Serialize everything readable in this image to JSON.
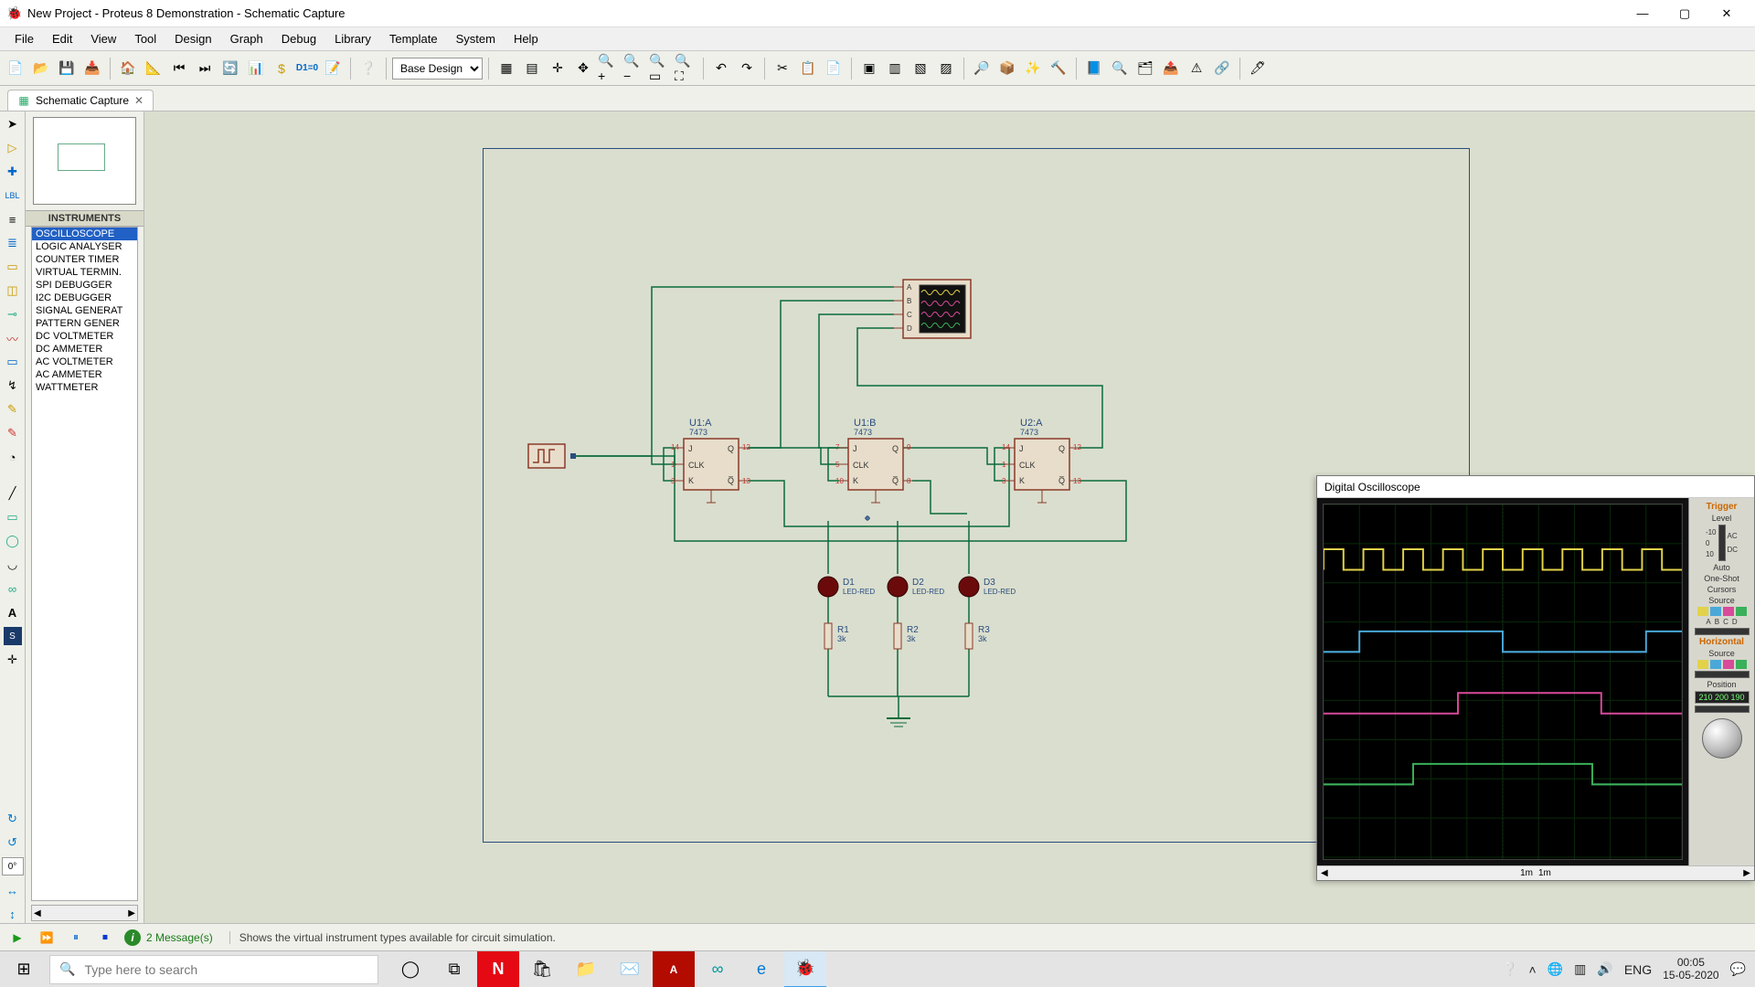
{
  "window": {
    "title": "New Project - Proteus 8 Demonstration - Schematic Capture"
  },
  "menu": [
    "File",
    "Edit",
    "View",
    "Tool",
    "Design",
    "Graph",
    "Debug",
    "Library",
    "Template",
    "System",
    "Help"
  ],
  "toolbar": {
    "design_variant_label": "Base Design"
  },
  "tab": {
    "label": "Schematic Capture"
  },
  "instruments": {
    "header": "INSTRUMENTS",
    "items": [
      "OSCILLOSCOPE",
      "LOGIC ANALYSER",
      "COUNTER TIMER",
      "VIRTUAL TERMIN.",
      "SPI DEBUGGER",
      "I2C DEBUGGER",
      "SIGNAL GENERAT",
      "PATTERN GENER",
      "DC VOLTMETER",
      "DC AMMETER",
      "AC VOLTMETER",
      "AC AMMETER",
      "WATTMETER"
    ],
    "selected_index": 0
  },
  "rotation_field": "0°",
  "schematic": {
    "chips": [
      {
        "ref": "U1:A",
        "part": "7473",
        "j": "14",
        "k": "3",
        "clk": "1",
        "q": "12",
        "qb": "13"
      },
      {
        "ref": "U1:B",
        "part": "7473",
        "j": "7",
        "k": "10",
        "clk": "5",
        "q": "9",
        "qb": "8"
      },
      {
        "ref": "U2:A",
        "part": "7473",
        "j": "14",
        "k": "3",
        "clk": "1",
        "q": "12",
        "qb": "13"
      }
    ],
    "clk_label": "CLK",
    "j_label": "J",
    "k_label": "K",
    "q_label": "Q",
    "qb_label": "Q̅",
    "scope_pins": [
      "A",
      "B",
      "C",
      "D"
    ],
    "leds": [
      {
        "ref": "D1",
        "part": "LED-RED"
      },
      {
        "ref": "D2",
        "part": "LED-RED"
      },
      {
        "ref": "D3",
        "part": "LED-RED"
      }
    ],
    "resistors": [
      {
        "ref": "R1",
        "val": "3k"
      },
      {
        "ref": "R2",
        "val": "3k"
      },
      {
        "ref": "R3",
        "val": "3k"
      }
    ]
  },
  "oscilloscope": {
    "title": "Digital Oscilloscope",
    "trigger_label": "Trigger",
    "level_label": "Level",
    "ac_label": "AC",
    "dc_label": "DC",
    "auto_label": "Auto",
    "oneshot_label": "One-Shot",
    "cursors_label": "Cursors",
    "source_label": "Source",
    "horizontal_label": "Horizontal",
    "position_label": "Position",
    "position_values": "210 200 190",
    "timebase": "1m",
    "unit": "1m",
    "source_letters": [
      "A",
      "B",
      "C",
      "D"
    ],
    "level_ticks": [
      "-10",
      "0",
      "10"
    ]
  },
  "simbar": {
    "messages_count": "2 Message(s)",
    "hint": "Shows the virtual instrument types available for circuit simulation."
  },
  "taskbar": {
    "search_placeholder": "Type here to search",
    "lang": "ENG",
    "time": "00:05",
    "date": "15-05-2020"
  },
  "colors": {
    "wire": "#0a6b3a",
    "chip_border": "#8a3a2a",
    "led_fill": "#6b0a0a",
    "trace_a": "#e2d24a",
    "trace_b": "#4aa8d8",
    "trace_c": "#d84a9a",
    "trace_d": "#3ab05a",
    "scope_text": "#c66a10"
  }
}
